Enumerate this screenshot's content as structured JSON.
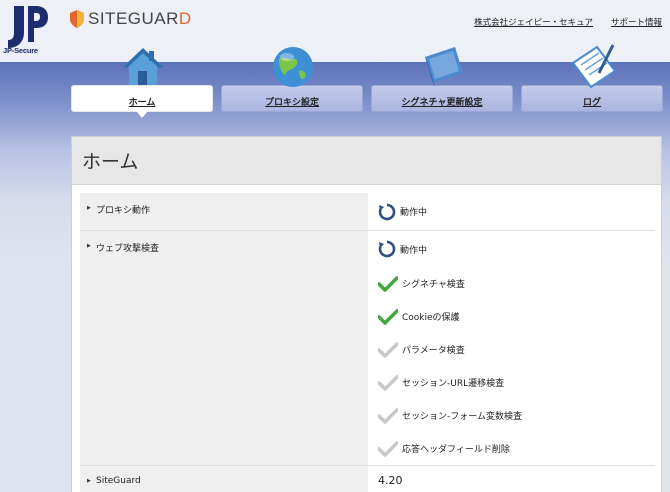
{
  "header": {
    "jp_logo_text": "JP-Secure",
    "brand_prefix": "SITEGUAR",
    "brand_suffix": "D",
    "links": [
      "株式会社ジェイピー・セキュア",
      "サポート情報"
    ]
  },
  "tabs": [
    {
      "label": "ホーム",
      "icon": "house-icon",
      "active": true
    },
    {
      "label": "プロキシ設定",
      "icon": "globe-icon",
      "active": false
    },
    {
      "label": "シグネチャ更新設定",
      "icon": "binder-icon",
      "active": false
    },
    {
      "label": "ログ",
      "icon": "notepad-icon",
      "active": false
    }
  ],
  "page_title": "ホーム",
  "rows": {
    "proxy": {
      "label": "プロキシ動作",
      "status": "動作中"
    },
    "web_attack": {
      "label": "ウェブ攻撃検査",
      "status": "動作中",
      "items": [
        {
          "label": "シグネチャ検査",
          "checked": true
        },
        {
          "label": "Cookieの保護",
          "checked": true
        },
        {
          "label": "パラメータ検査",
          "checked": false
        },
        {
          "label": "セッション-URL遷移検査",
          "checked": false
        },
        {
          "label": "セッション-フォーム変数検査",
          "checked": false
        },
        {
          "label": "応答ヘッダフィールド削除",
          "checked": false
        }
      ]
    },
    "version": {
      "label": "SiteGuard",
      "value": "4.20"
    }
  },
  "colors": {
    "check_on": "#3fa83a",
    "check_off": "#c8c8c8",
    "tab_bg": "#aab6e0",
    "status_icon": "#2f4f86"
  }
}
